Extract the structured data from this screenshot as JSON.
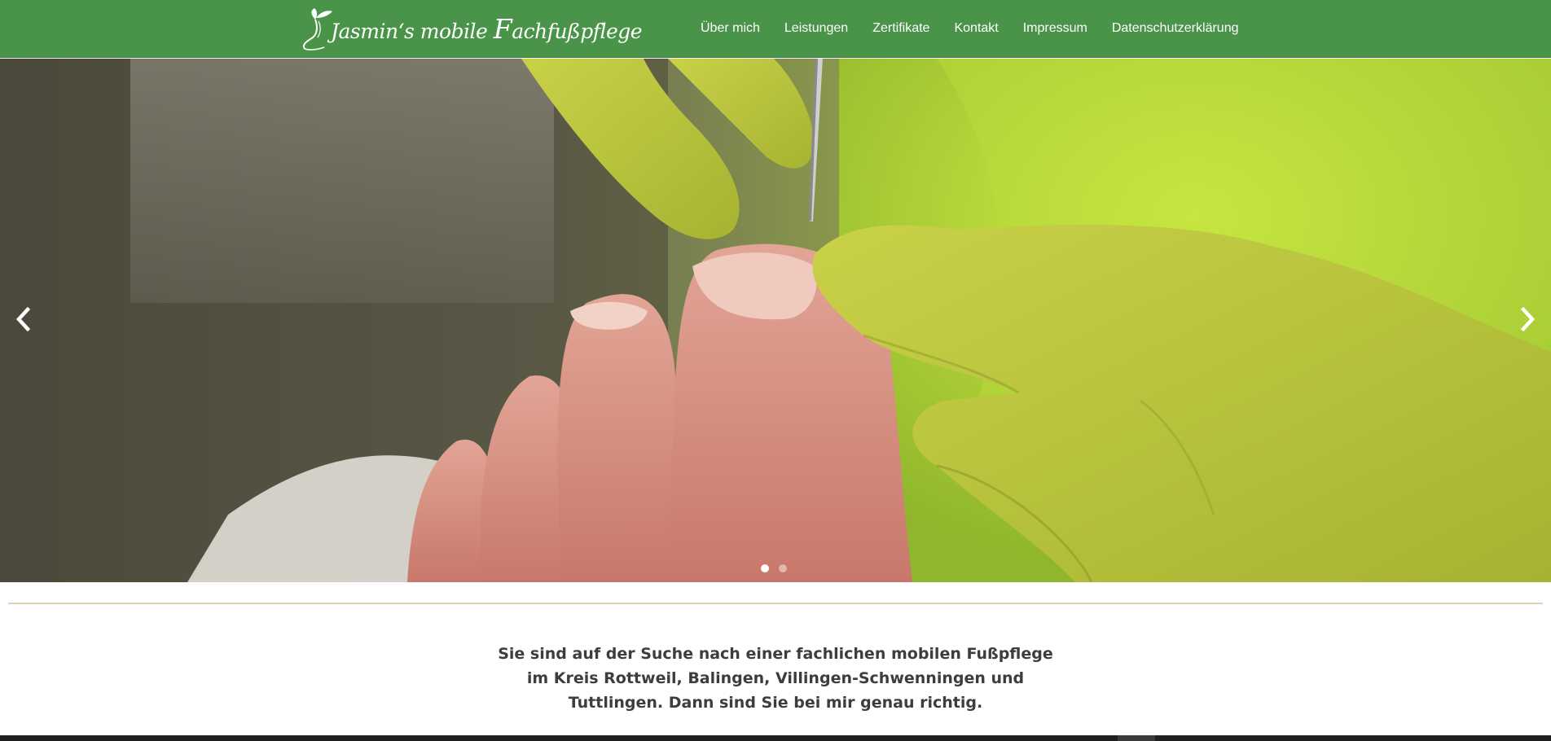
{
  "header": {
    "logo": {
      "name_part1": "Jasmin‘s mobile ",
      "name_cap": "F",
      "name_part2": "achfußpflege",
      "icon": "foot-leaf-icon"
    },
    "nav": [
      {
        "label": "Über mich"
      },
      {
        "label": "Leistungen"
      },
      {
        "label": "Zertifikate"
      },
      {
        "label": "Kontakt"
      },
      {
        "label": "Impressum"
      },
      {
        "label": "Datenschutzerklärung"
      }
    ]
  },
  "slider": {
    "image": "Fußpflege: toenail being treated by hands in green gloves",
    "prev_icon": "chevron-left-icon",
    "next_icon": "chevron-right-icon",
    "slide_count": 2,
    "active_slide": 1
  },
  "intro": {
    "lines": [
      "Sie sind auf der Suche nach einer fachlichen mobilen Fußpflege",
      "im Kreis Rottweil, Balingen, Villingen-Schwenningen und",
      "Tuttlingen. Dann sind Sie bei mir genau richtig."
    ]
  },
  "colors": {
    "header_bg": "#4a944a",
    "divider": "#e3d3b5",
    "text": "#3d3d3d",
    "glove": "#b8c43a"
  }
}
